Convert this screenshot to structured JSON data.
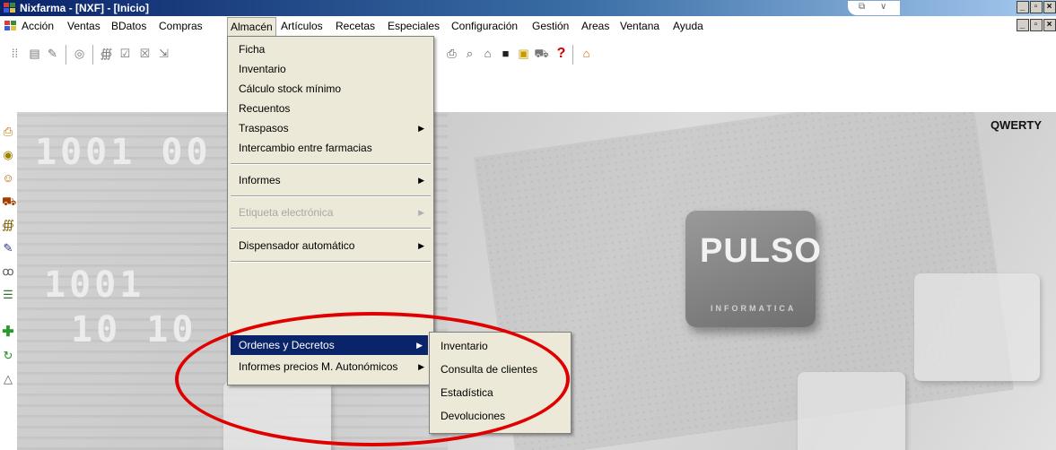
{
  "window": {
    "title": "Nixfarma - [NXF] - [Inicio]"
  },
  "menubar": {
    "items": [
      "Acción",
      "Ventas",
      "BDatos",
      "Compras",
      "Almacén",
      "Artículos",
      "Recetas",
      "Especiales",
      "Configuración",
      "Gestión",
      "Areas",
      "Ventana",
      "Ayuda"
    ],
    "active": "Almacén"
  },
  "main": {
    "user_label": "QWERTY",
    "brand": "PULSO",
    "brand_sub": "INFORMATICA",
    "background_digits": [
      "1001 00",
      "1001",
      "10 10"
    ]
  },
  "almacen_menu": {
    "items": [
      {
        "label": "Ficha"
      },
      {
        "label": "Inventario"
      },
      {
        "label": "Cálculo stock mínimo"
      },
      {
        "label": "Recuentos"
      },
      {
        "label": "Traspasos",
        "submenu": true
      },
      {
        "label": "Intercambio entre farmacias"
      },
      {
        "label": "Informes",
        "submenu": true
      },
      {
        "label": "Etiqueta electrónica",
        "submenu": true,
        "disabled": true
      },
      {
        "label": "Dispensador automático",
        "submenu": true
      },
      {
        "label": "Ordenes y Decretos",
        "submenu": true,
        "selected": true
      },
      {
        "label": "Informes precios M. Autonómicos",
        "submenu": true
      }
    ]
  },
  "ordenes_submenu": {
    "items": [
      "Inventario",
      "Consulta de clientes",
      "Estadística",
      "Devoluciones"
    ]
  },
  "colors": {
    "menu_bg": "#ece9d8",
    "selection": "#0a246a",
    "highlight_ellipse": "#e00000",
    "titlebar": "#0a246a"
  },
  "icons": {
    "toolbar": [
      "layout-icon",
      "document-icon",
      "edit-icon",
      "globe-icon",
      "binoculars-icon",
      "checklist-icon",
      "close-doc-icon",
      "export-icon",
      "print-icon",
      "search-icon",
      "home-icon",
      "square-icon",
      "window-icon",
      "cart-icon",
      "help-icon",
      "home-up-icon"
    ],
    "left": [
      "printer-icon",
      "coin-icon",
      "user-icon",
      "cart-icon",
      "binoculars-icon",
      "pencil-icon",
      "people-icon",
      "cashbox-icon",
      "plus-icon",
      "refresh-icon",
      "up-icon"
    ]
  }
}
